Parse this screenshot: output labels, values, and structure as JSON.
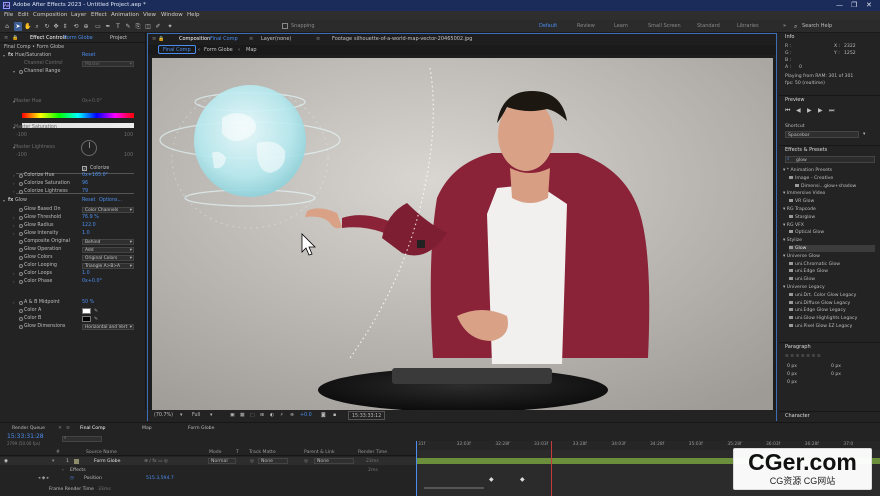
{
  "window": {
    "title": "Adobe After Effects 2023 - Untitled Project.aep *",
    "app_badge": "Ae",
    "controls": [
      "—",
      "❐",
      "✕"
    ]
  },
  "menu": [
    "File",
    "Edit",
    "Composition",
    "Layer",
    "Effect",
    "Animation",
    "View",
    "Window",
    "Help"
  ],
  "toolbar": {
    "snapping_label": "Snapping",
    "workspaces": [
      "Default",
      "Review",
      "Learn",
      "Small Screen",
      "Standard",
      "Libraries"
    ],
    "search_help": "Search Help"
  },
  "effect_controls": {
    "project_tab": "Project",
    "tab_label": "Effect Controls",
    "layer_name": "Form Globe",
    "breadcrumb": "Final Comp • Form Globe",
    "hue_saturation": {
      "name": "Hue/Saturation",
      "reset": "Reset",
      "channel_control_label": "Channel Control",
      "channel_control_value": "Master",
      "channel_range_label": "Channel Range",
      "master_hue_label": "Master Hue",
      "master_hue_value": "0x+0.0°",
      "master_saturation_label": "Master Saturation",
      "master_lightness_label": "Master Lightness",
      "slider_min": "-100",
      "slider_max": "100",
      "colorize_label": "Colorize",
      "colorize_hue_label": "Colorize Hue",
      "colorize_hue_value": "0x+165.0°",
      "colorize_saturation_label": "Colorize Saturation",
      "colorize_saturation_value": "96",
      "colorize_lightness_label": "Colorize Lightness",
      "colorize_lightness_value": "79"
    },
    "glow": {
      "name": "Glow",
      "reset": "Reset",
      "options": "Options...",
      "rows": [
        {
          "label": "Glow Based On",
          "value": "Color Channels",
          "type": "drop"
        },
        {
          "label": "Glow Threshold",
          "value": "76.9 %",
          "type": "num"
        },
        {
          "label": "Glow Radius",
          "value": "122.0",
          "type": "num"
        },
        {
          "label": "Glow Intensity",
          "value": "1.0",
          "type": "num"
        },
        {
          "label": "Composite Original",
          "value": "Behind",
          "type": "drop"
        },
        {
          "label": "Glow Operation",
          "value": "Add",
          "type": "drop"
        },
        {
          "label": "Glow Colors",
          "value": "Original Colors",
          "type": "drop"
        },
        {
          "label": "Color Looping",
          "value": "Triangle A>B>A",
          "type": "drop"
        },
        {
          "label": "Color Loops",
          "value": "1.0",
          "type": "num"
        },
        {
          "label": "Color Phase",
          "value": "0x+0.0°",
          "type": "num"
        }
      ],
      "ab_midpoint_label": "A & B Midpoint",
      "ab_midpoint_value": "50 %",
      "color_a_label": "Color A",
      "color_b_label": "Color B",
      "glow_dimensions_label": "Glow Dimensions",
      "glow_dimensions_value": "Horizontal and Vert"
    }
  },
  "composition": {
    "panel_label": "Composition",
    "comp_name": "Final Comp",
    "layer_panel_label": "Layer",
    "layer_panel_value": "(none)",
    "footage_label": "Footage",
    "footage_name": "silhouette-of-a-world-map-vector-20465002.jpg",
    "tabs": [
      "Final Comp",
      "Form Globe",
      "Map"
    ],
    "zoom": "(70.7%)",
    "resolution": "Full",
    "exposure": "+0.0",
    "timecode": "15:33:33:12"
  },
  "info": {
    "title": "Info",
    "x_label": "X :",
    "x_value": "2322",
    "y_label": "Y :",
    "y_value": "1252",
    "r_label": "R :",
    "g_label": "G :",
    "b_label": "B :",
    "a_label": "A :",
    "a_value": "0",
    "playing_line1": "Playing from RAM: 301 of 301",
    "playing_line2": "fps: 50 (realtime)"
  },
  "preview": {
    "title": "Preview",
    "shortcut_label": "Shortcut",
    "shortcut_value": "Spacebar"
  },
  "effects_presets": {
    "title": "Effects & Presets",
    "search_value": "glow",
    "tree": [
      {
        "label": "* Animation Presets",
        "indent": 0,
        "type": "group"
      },
      {
        "label": "Image - Creative",
        "indent": 1,
        "type": "folder"
      },
      {
        "label": "Dimensi...glow+shadow",
        "indent": 2,
        "type": "item"
      },
      {
        "label": "Immersive Video",
        "indent": 0,
        "type": "group"
      },
      {
        "label": "VR Glow",
        "indent": 1,
        "type": "item"
      },
      {
        "label": "RG Trapcode",
        "indent": 0,
        "type": "group"
      },
      {
        "label": "Starglow",
        "indent": 1,
        "type": "item"
      },
      {
        "label": "RG VFX",
        "indent": 0,
        "type": "group"
      },
      {
        "label": "Optical Glow",
        "indent": 1,
        "type": "item"
      },
      {
        "label": "Stylize",
        "indent": 0,
        "type": "group"
      },
      {
        "label": "Glow",
        "indent": 1,
        "type": "item",
        "selected": true
      },
      {
        "label": "Universe Glow",
        "indent": 0,
        "type": "group"
      },
      {
        "label": "uni.Chromatic Glow",
        "indent": 1,
        "type": "item"
      },
      {
        "label": "uni.Edge Glow",
        "indent": 1,
        "type": "item"
      },
      {
        "label": "uni.Glow",
        "indent": 1,
        "type": "item"
      },
      {
        "label": "Universe Legacy",
        "indent": 0,
        "type": "group"
      },
      {
        "label": "uni.Drt. Color Glow Legacy",
        "indent": 1,
        "type": "item"
      },
      {
        "label": "uni.Diffuse Glow Legacy",
        "indent": 1,
        "type": "item"
      },
      {
        "label": "uni.Edge Glow Legacy",
        "indent": 1,
        "type": "item"
      },
      {
        "label": "uni.Glow Highlights Legacy",
        "indent": 1,
        "type": "item"
      },
      {
        "label": "uni.Pixel Glow EZ Legacy",
        "indent": 1,
        "type": "item"
      }
    ]
  },
  "paragraph": {
    "title": "Paragraph",
    "values": [
      "0 px",
      "0 px",
      "0 px",
      "0 px",
      "0 px"
    ]
  },
  "character": {
    "title": "Character"
  },
  "timeline": {
    "render_queue_tab": "Render Queue",
    "comp_tabs": [
      "Final Comp",
      "Map",
      "Form Globe"
    ],
    "timecode": "15:33:31:28",
    "fps_info": "2799 (50.00 fps)",
    "columns": [
      "#",
      "Source Name",
      "Mode",
      "T",
      "Track Matte",
      "Parent & Link",
      "Render Time"
    ],
    "layer": {
      "number": "1",
      "name": "Form Globe",
      "mode": "Normal",
      "track_matte": "None",
      "parent": "None",
      "render_time": "23ms"
    },
    "effects_label": "Effects",
    "render_time_value": "2ms",
    "position_label": "Position",
    "position_value": "515.3,594.7",
    "frame_render_time_label": "Frame Render Time",
    "frame_render_time_value": "33ms",
    "ruler": [
      "31f",
      "32:03f",
      "32:28f",
      "33:03f",
      "33:28f",
      "34:03f",
      "34:28f",
      "35:03f",
      "35:28f",
      "36:03f",
      "36:28f",
      "37:0"
    ]
  },
  "watermark": {
    "title": "CGer.com",
    "subtitle": "CG资源 CG网站"
  },
  "colors": {
    "accent": "#4b8ef0",
    "title_bar": "#1b2c5a",
    "panel": "#232323",
    "playhead": "#4b8ef0",
    "track_bar": "#6b8f3a"
  }
}
